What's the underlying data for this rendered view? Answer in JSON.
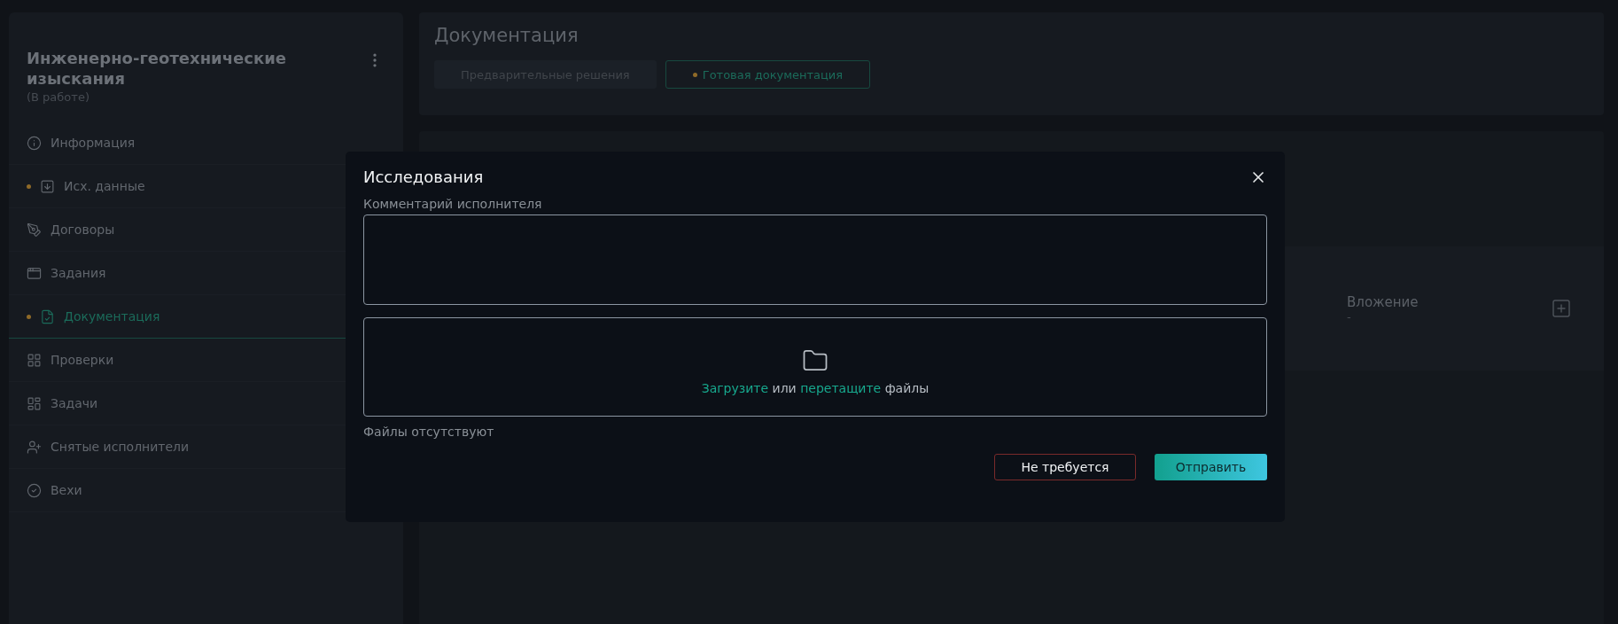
{
  "sidebar": {
    "title": "Инженерно-геотехнические изыскания",
    "status": "(В работе)",
    "items": [
      {
        "label": "Информация",
        "marked": false,
        "selected": false
      },
      {
        "label": "Исх. данные",
        "marked": true,
        "selected": false
      },
      {
        "label": "Договоры",
        "marked": false,
        "selected": false
      },
      {
        "label": "Задания",
        "marked": false,
        "selected": false
      },
      {
        "label": "Документация",
        "marked": true,
        "selected": true
      },
      {
        "label": "Проверки",
        "marked": false,
        "selected": false
      },
      {
        "label": "Задачи",
        "marked": false,
        "selected": false
      },
      {
        "label": "Снятые исполнители",
        "marked": false,
        "selected": false
      },
      {
        "label": "Вехи",
        "marked": false,
        "selected": false
      }
    ]
  },
  "main": {
    "title": "Документация",
    "tabs": [
      {
        "label": "Предварительные решения",
        "selected": false,
        "marked": false
      },
      {
        "label": "Готовая документация",
        "selected": true,
        "marked": true
      }
    ],
    "attachment": {
      "label": "Вложение",
      "value": "-"
    }
  },
  "modal": {
    "title": "Исследования",
    "comment_label": "Комментарий исполнителя",
    "upload_hint": [
      {
        "kind": "link",
        "text": "Загрузите"
      },
      {
        "kind": "text",
        "text": " или "
      },
      {
        "kind": "link",
        "text": "перетащите"
      },
      {
        "kind": "text",
        "text": " файлы"
      }
    ],
    "files_note": "Файлы отсутствуют",
    "buttons": [
      {
        "label": "Не требуется",
        "kind": "secondary"
      },
      {
        "label": "Отправить",
        "kind": "primary"
      }
    ]
  }
}
